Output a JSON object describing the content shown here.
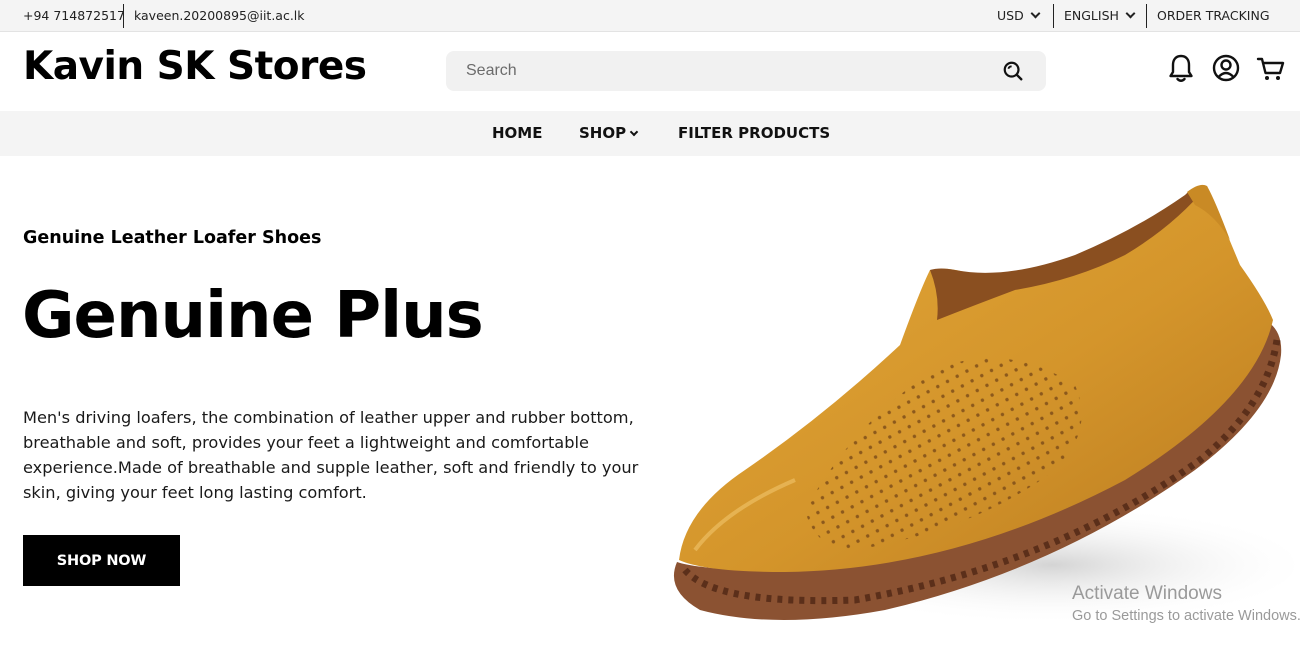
{
  "topbar": {
    "phone": "+94 714872517",
    "email": "kaveen.20200895@iit.ac.lk",
    "currency": "USD",
    "language": "ENGLISH",
    "order_tracking": "ORDER TRACKING"
  },
  "header": {
    "brand": "Kavin SK Stores",
    "search_placeholder": "Search",
    "search_value": "",
    "icons": [
      "search-icon",
      "bell-icon",
      "user-icon",
      "cart-icon"
    ]
  },
  "nav": {
    "items": [
      {
        "label": "HOME"
      },
      {
        "label": "SHOP"
      },
      {
        "label": "FILTER PRODUCTS"
      }
    ]
  },
  "hero": {
    "subtitle": "Genuine Leather Loafer Shoes",
    "title": "Genuine Plus",
    "description": "Men's driving loafers, the combination of leather upper and rubber bottom, breathable and soft, provides your feet a lightweight and comfortable experience.Made of breathable and supple leather, soft and friendly to your skin, giving your feet long lasting comfort.",
    "cta": "SHOP NOW",
    "image": "tan-leather-loafer-shoe"
  },
  "watermark": {
    "line1": "Activate Windows",
    "line2": "Go to Settings to activate Windows."
  },
  "colors": {
    "bar_bg": "#f4f4f4",
    "search_bg": "#f1f1f1",
    "cta_bg": "#000000",
    "shoe_leather": "#d89a2e",
    "shoe_stitch": "#7a4528"
  }
}
